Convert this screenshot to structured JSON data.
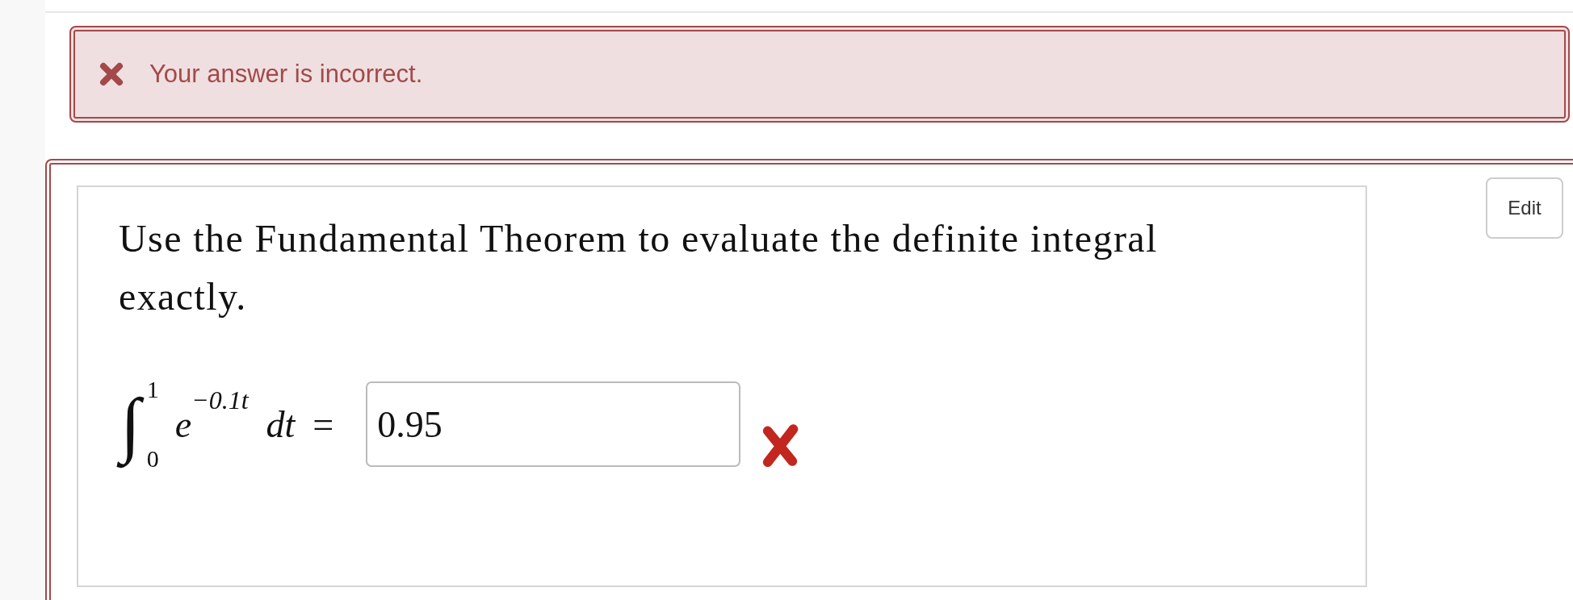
{
  "feedback": {
    "kind": "error",
    "message": "Your answer is incorrect."
  },
  "question": {
    "prompt": "Use the Fundamental Theorem to evaluate the definite integral exactly.",
    "expression": {
      "integral_sign": "∫",
      "upper_limit": "1",
      "lower_limit": "0",
      "base": "e",
      "exponent": "−0.1t",
      "differential": "dt",
      "equals": "="
    },
    "answer": {
      "value": "0.95",
      "correct": false
    }
  },
  "edit_button": "Edit"
}
